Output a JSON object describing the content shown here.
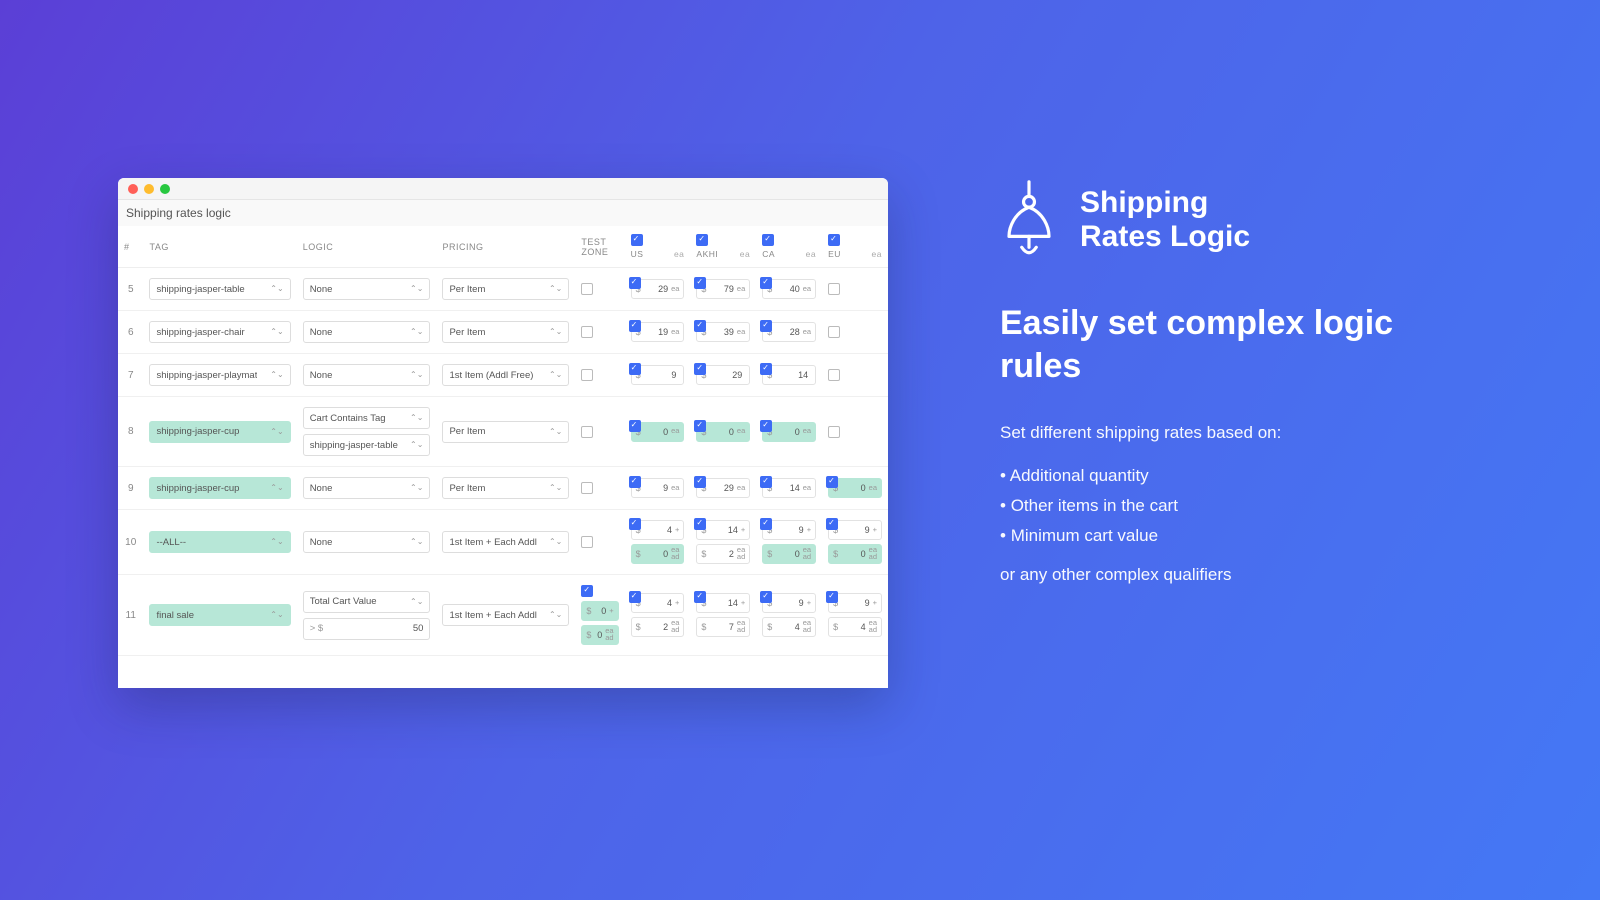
{
  "breadcrumb": "Shipping rates logic",
  "columns": {
    "num": "#",
    "tag": "TAG",
    "logic": "LOGIC",
    "pricing": "PRICING",
    "testzone": "TEST ZONE"
  },
  "zones": [
    {
      "name": "US",
      "checked": true,
      "ea": "ea"
    },
    {
      "name": "AKHI",
      "checked": true,
      "ea": "ea"
    },
    {
      "name": "CA",
      "checked": true,
      "ea": "ea"
    },
    {
      "name": "EU",
      "checked": true,
      "ea": "ea"
    }
  ],
  "rows": [
    {
      "n": "5",
      "tag": "shipping-jasper-table",
      "tag_hl": false,
      "logic": [
        "None"
      ],
      "logic2": [],
      "pricing": "Per Item",
      "test_checked": false,
      "zones": [
        {
          "lines": [
            {
              "chk": true,
              "cur": "$",
              "amt": "29",
              "unit": "ea",
              "hl": false
            }
          ]
        },
        {
          "lines": [
            {
              "chk": true,
              "cur": "$",
              "amt": "79",
              "unit": "ea",
              "hl": false
            }
          ]
        },
        {
          "lines": [
            {
              "chk": true,
              "cur": "$",
              "amt": "40",
              "unit": "ea",
              "hl": false
            }
          ]
        },
        {
          "lines": [
            {
              "chk": false
            }
          ]
        }
      ]
    },
    {
      "n": "6",
      "tag": "shipping-jasper-chair",
      "tag_hl": false,
      "logic": [
        "None"
      ],
      "logic2": [],
      "pricing": "Per Item",
      "test_checked": false,
      "zones": [
        {
          "lines": [
            {
              "chk": true,
              "cur": "$",
              "amt": "19",
              "unit": "ea",
              "hl": false
            }
          ]
        },
        {
          "lines": [
            {
              "chk": true,
              "cur": "$",
              "amt": "39",
              "unit": "ea",
              "hl": false
            }
          ]
        },
        {
          "lines": [
            {
              "chk": true,
              "cur": "$",
              "amt": "28",
              "unit": "ea",
              "hl": false
            }
          ]
        },
        {
          "lines": [
            {
              "chk": false
            }
          ]
        }
      ]
    },
    {
      "n": "7",
      "tag": "shipping-jasper-playmat",
      "tag_hl": false,
      "logic": [
        "None"
      ],
      "logic2": [],
      "pricing": "1st Item (Addl Free)",
      "test_checked": false,
      "zones": [
        {
          "lines": [
            {
              "chk": true,
              "cur": "$",
              "amt": "9",
              "unit": "",
              "hl": false
            }
          ]
        },
        {
          "lines": [
            {
              "chk": true,
              "cur": "$",
              "amt": "29",
              "unit": "",
              "hl": false
            }
          ]
        },
        {
          "lines": [
            {
              "chk": true,
              "cur": "$",
              "amt": "14",
              "unit": "",
              "hl": false
            }
          ]
        },
        {
          "lines": [
            {
              "chk": false
            }
          ]
        }
      ]
    },
    {
      "n": "8",
      "tag": "shipping-jasper-cup",
      "tag_hl": true,
      "logic": [
        "Cart Contains Tag"
      ],
      "logic2": [
        "shipping-jasper-table"
      ],
      "pricing": "Per Item",
      "test_checked": false,
      "zones": [
        {
          "lines": [
            {
              "chk": true,
              "cur": "$",
              "amt": "0",
              "unit": "ea",
              "hl": true
            }
          ]
        },
        {
          "lines": [
            {
              "chk": true,
              "cur": "$",
              "amt": "0",
              "unit": "ea",
              "hl": true
            }
          ]
        },
        {
          "lines": [
            {
              "chk": true,
              "cur": "$",
              "amt": "0",
              "unit": "ea",
              "hl": true
            }
          ]
        },
        {
          "lines": [
            {
              "chk": false
            }
          ]
        }
      ]
    },
    {
      "n": "9",
      "tag": "shipping-jasper-cup",
      "tag_hl": true,
      "logic": [
        "None"
      ],
      "logic2": [],
      "pricing": "Per Item",
      "test_checked": false,
      "zones": [
        {
          "lines": [
            {
              "chk": true,
              "cur": "$",
              "amt": "9",
              "unit": "ea",
              "hl": false
            }
          ]
        },
        {
          "lines": [
            {
              "chk": true,
              "cur": "$",
              "amt": "29",
              "unit": "ea",
              "hl": false
            }
          ]
        },
        {
          "lines": [
            {
              "chk": true,
              "cur": "$",
              "amt": "14",
              "unit": "ea",
              "hl": false
            }
          ]
        },
        {
          "lines": [
            {
              "chk": true,
              "cur": "$",
              "amt": "0",
              "unit": "ea",
              "hl": true
            }
          ]
        }
      ]
    },
    {
      "n": "10",
      "tag": "--ALL--",
      "tag_hl": true,
      "logic": [
        "None"
      ],
      "logic2": [],
      "pricing": "1st Item + Each Addl",
      "test_checked": false,
      "zones": [
        {
          "lines": [
            {
              "chk": true,
              "cur": "$",
              "amt": "4",
              "unit": "+",
              "hl": false
            },
            {
              "chk": false,
              "cur": "$",
              "amt": "0",
              "unit": "ea\nad",
              "hl": true
            }
          ]
        },
        {
          "lines": [
            {
              "chk": true,
              "cur": "$",
              "amt": "14",
              "unit": "+",
              "hl": false
            },
            {
              "chk": false,
              "cur": "$",
              "amt": "2",
              "unit": "ea\nad",
              "hl": false
            }
          ]
        },
        {
          "lines": [
            {
              "chk": true,
              "cur": "$",
              "amt": "9",
              "unit": "+",
              "hl": false
            },
            {
              "chk": false,
              "cur": "$",
              "amt": "0",
              "unit": "ea\nad",
              "hl": true
            }
          ]
        },
        {
          "lines": [
            {
              "chk": true,
              "cur": "$",
              "amt": "9",
              "unit": "+",
              "hl": false
            },
            {
              "chk": false,
              "cur": "$",
              "amt": "0",
              "unit": "ea\nad",
              "hl": true
            }
          ]
        }
      ]
    },
    {
      "n": "11",
      "tag": "final sale",
      "tag_hl": true,
      "logic": [
        "Total Cart Value"
      ],
      "logic_input": {
        "op": "> $",
        "val": "50"
      },
      "pricing": "1st Item + Each Addl",
      "test_checked": true,
      "test_lines": [
        {
          "cur": "$",
          "amt": "0",
          "unit": "+",
          "hl": true
        },
        {
          "cur": "$",
          "amt": "0",
          "unit": "ea\nad",
          "hl": true
        }
      ],
      "zones": [
        {
          "lines": [
            {
              "chk": true,
              "cur": "$",
              "amt": "4",
              "unit": "+",
              "hl": false
            },
            {
              "chk": false,
              "cur": "$",
              "amt": "2",
              "unit": "ea\nad",
              "hl": false
            }
          ]
        },
        {
          "lines": [
            {
              "chk": true,
              "cur": "$",
              "amt": "14",
              "unit": "+",
              "hl": false
            },
            {
              "chk": false,
              "cur": "$",
              "amt": "7",
              "unit": "ea\nad",
              "hl": false
            }
          ]
        },
        {
          "lines": [
            {
              "chk": true,
              "cur": "$",
              "amt": "9",
              "unit": "+",
              "hl": false
            },
            {
              "chk": false,
              "cur": "$",
              "amt": "4",
              "unit": "ea\nad",
              "hl": false
            }
          ]
        },
        {
          "lines": [
            {
              "chk": true,
              "cur": "$",
              "amt": "9",
              "unit": "+",
              "hl": false
            },
            {
              "chk": false,
              "cur": "$",
              "amt": "4",
              "unit": "ea\nad",
              "hl": false
            }
          ]
        }
      ]
    }
  ],
  "promo": {
    "brand1": "Shipping",
    "brand2": "Rates Logic",
    "headline": "Easily set complex logic rules",
    "lead": "Set different shipping rates based on:",
    "bullets": [
      "Additional quantity",
      "Other items in the cart",
      "Minimum cart value"
    ],
    "tail": "or any other complex qualifiers"
  }
}
